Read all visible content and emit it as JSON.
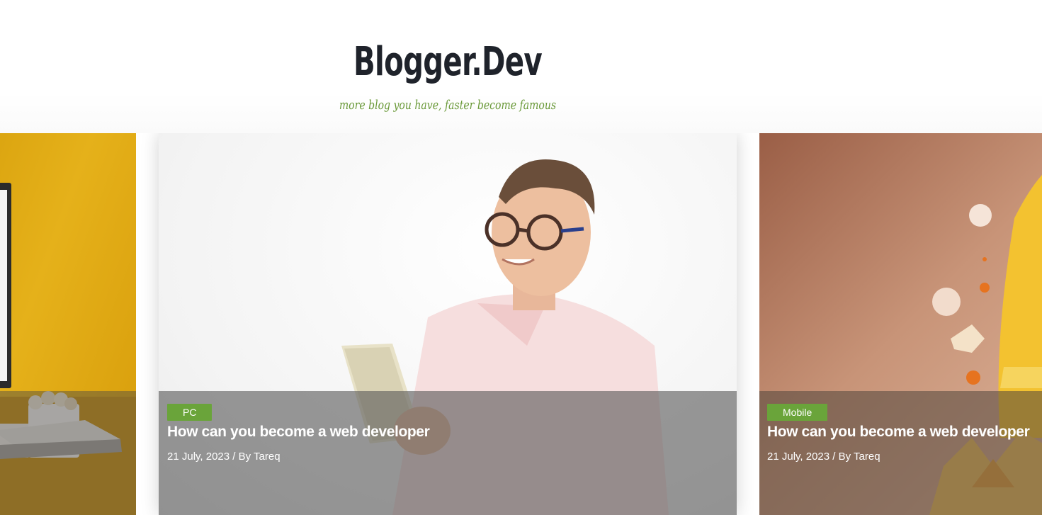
{
  "header": {
    "site_title": "Blogger.Dev",
    "tagline": "more blog you have, faster become famous"
  },
  "colors": {
    "accent_green": "#6aa43a",
    "title_dark": "#1f232b",
    "tagline_green": "#6b9a3a"
  },
  "slides": [
    {
      "image": "desk-monitor-yellow-photo"
    },
    {
      "image": "man-holding-tablet-photo",
      "category": "PC",
      "title": "How can you become a web developer",
      "meta": "21 July, 2023 / By Tareq"
    },
    {
      "image": "rocket-illustration-photo",
      "category": "Mobile",
      "title": "How can you become a web developer",
      "meta": "21 July, 2023 / By Tareq"
    }
  ]
}
